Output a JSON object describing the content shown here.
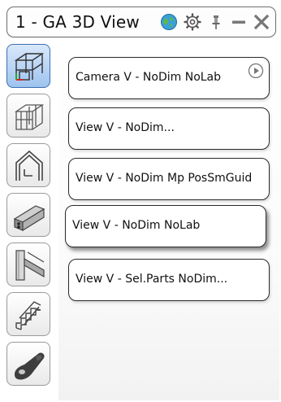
{
  "window": {
    "title": "1 - GA 3D View"
  },
  "titlebar_icons": [
    "globe-icon",
    "gear-icon",
    "pin-icon",
    "minimize-icon",
    "close-icon"
  ],
  "sidebar": {
    "items": [
      {
        "name": "general-arrangement-3d-icon",
        "active": true
      },
      {
        "name": "building-frame-icon",
        "active": false
      },
      {
        "name": "house-outline-icon",
        "active": false
      },
      {
        "name": "beam-profile-icon",
        "active": false
      },
      {
        "name": "steel-connection-icon",
        "active": false
      },
      {
        "name": "stairs-icon",
        "active": false
      },
      {
        "name": "wrench-bolt-icon",
        "active": false
      }
    ]
  },
  "views": [
    {
      "label": "Camera V - NoDim NoLab"
    },
    {
      "label": "View V - NoDim..."
    },
    {
      "label": "View V - NoDim Mp PosSmGuid"
    },
    {
      "label": "View V - NoDim NoLab"
    },
    {
      "label": "View V - Sel.Parts NoDim..."
    }
  ],
  "colors": {
    "active_tab": "#9ec3ef",
    "border": "#2a2a2a"
  }
}
